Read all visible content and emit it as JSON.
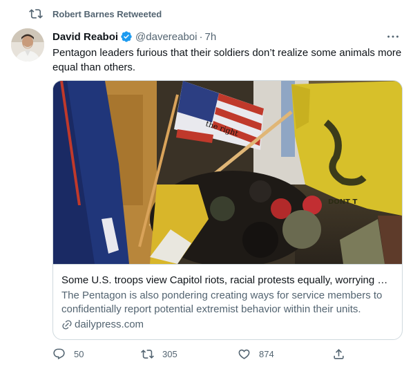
{
  "social_context": {
    "text": "Robert Barnes Retweeted"
  },
  "tweet": {
    "display_name": "David Reaboi",
    "handle": "@davereaboi",
    "separator": "·",
    "time": "7h",
    "text": "Pentagon leaders furious that their soldiers don’t realize some animals more equal than others."
  },
  "card": {
    "title": "Some U.S. troops view Capitol riots, racial protests equally, worrying Pe…",
    "description": "The Pentagon is also pondering creating ways for service members to confidentially report potential extremist behavior within their units.",
    "domain": "dailypress.com",
    "image_flag_text": "DONT T"
  },
  "actions": {
    "replies": "50",
    "retweets": "305",
    "likes": "874"
  },
  "colors": {
    "verified": "#1d9bf0",
    "secondary_text": "#536471",
    "border": "#cfd9de"
  },
  "icons": [
    "retweet-icon",
    "verified-badge-icon",
    "more-icon",
    "link-icon",
    "reply-icon",
    "like-icon",
    "share-icon"
  ]
}
